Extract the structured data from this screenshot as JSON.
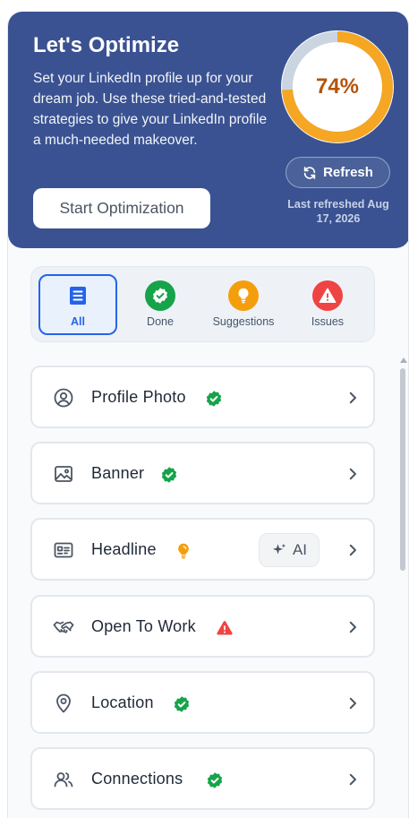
{
  "hero": {
    "title": "Let's Optimize",
    "description": "Set your LinkedIn profile up for your dream job. Use these tried-and-tested strategies to give your LinkedIn profile a much-needed makeover.",
    "start_button": "Start Optimization",
    "score_text": "74%",
    "score_value": 74,
    "refresh_label": "Refresh",
    "last_refreshed": "Last refreshed Aug 17, 2026",
    "colors": {
      "background": "#3a5291",
      "progress": "#f5a623",
      "track": "#cbd5e1"
    }
  },
  "filters": [
    {
      "label": "All",
      "icon": "list-icon",
      "active": true
    },
    {
      "label": "Done",
      "icon": "check-badge-icon",
      "color": "#16a34a"
    },
    {
      "label": "Suggestions",
      "icon": "lightbulb-icon",
      "color": "#f59e0b"
    },
    {
      "label": "Issues",
      "icon": "warning-icon",
      "color": "#ef4444"
    }
  ],
  "items": [
    {
      "label": "Profile Photo",
      "icon": "user-circle-icon",
      "status": "done"
    },
    {
      "label": "Banner",
      "icon": "image-icon",
      "status": "done"
    },
    {
      "label": "Headline",
      "icon": "id-card-icon",
      "status": "suggestion",
      "ai_label": "AI"
    },
    {
      "label": "Open To Work",
      "icon": "handshake-icon",
      "status": "issue"
    },
    {
      "label": "Location",
      "icon": "map-pin-icon",
      "status": "done"
    },
    {
      "label": "Connections",
      "icon": "users-icon",
      "status": "done"
    }
  ]
}
